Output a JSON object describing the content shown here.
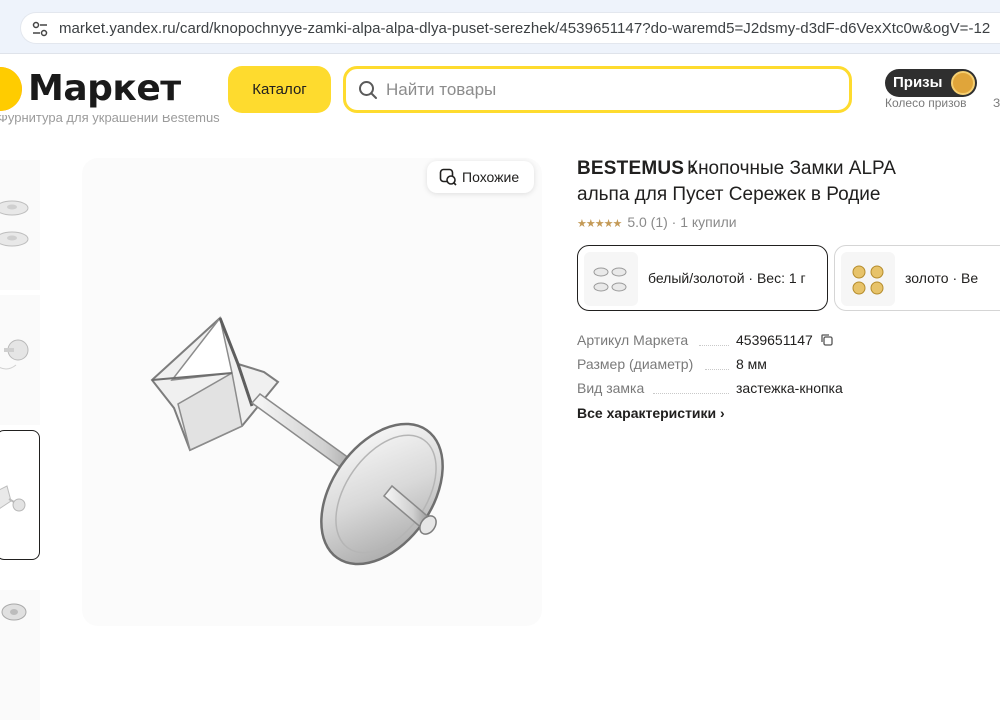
{
  "browser": {
    "url": "market.yandex.ru/card/knopochnyye-zamki-alpa-alpa-dlya-puset-serezhek/4539651147?do-waremd5=J2dsmy-d3dF-d6VexXtc0w&ogV=-12"
  },
  "header": {
    "logo_text": "Маркет",
    "catalog_label": "Каталог",
    "search_placeholder": "Найти товары",
    "prizes_label": "Призы",
    "prizes_sub": "Колесо призов",
    "cut_char": "З"
  },
  "breadcrumb": "Фурнитура для украшений Bestemus",
  "gallery": {
    "similar_label": "Похожие"
  },
  "product": {
    "brand": "BESTEMUS",
    "brand_chevron": "›",
    "title_line1": "Кнопочные Замки ALPA",
    "title_line2": "альпа для Пусет Сережек в Родие",
    "stars": "★★★★★",
    "rating": "5.0 (1) · 1 купили"
  },
  "variants": [
    {
      "label": "белый/золотой · Вес: 1 г"
    },
    {
      "label": "золото · Ве"
    }
  ],
  "specs": [
    {
      "key": "Артикул Маркета",
      "value": "4539651147"
    },
    {
      "key": "Размер (диаметр)",
      "value": "8 мм"
    },
    {
      "key": "Вид замка",
      "value": "застежка-кнопка"
    }
  ],
  "all_specs_label": "Все характеристики ›",
  "colors": {
    "accent_yellow": "#fedb2e",
    "brand_orange": "#ff7a00",
    "star": "#c49a57"
  }
}
